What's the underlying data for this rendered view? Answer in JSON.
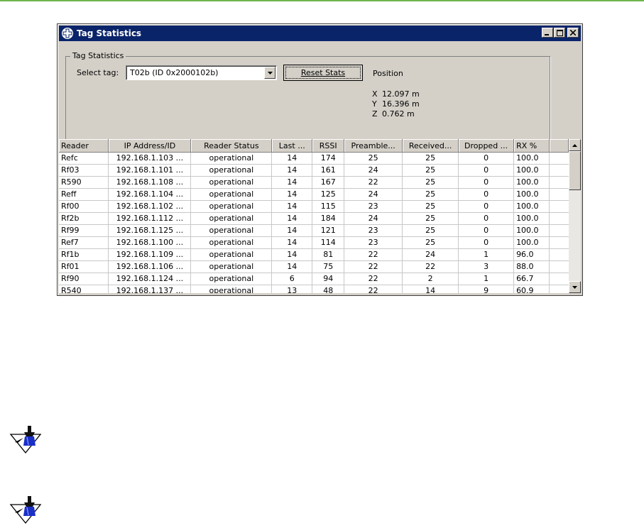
{
  "window": {
    "title": "Tag Statistics"
  },
  "group": {
    "legend": "Tag Statistics",
    "select_label": "Select tag:",
    "selected_tag": "T02b (ID 0x2000102b)",
    "reset_button": "Reset Stats",
    "position_label": "Position",
    "position": [
      {
        "axis": "X",
        "value": "12.097 m"
      },
      {
        "axis": "Y",
        "value": "16.396 m"
      },
      {
        "axis": "Z",
        "value": "0.762 m"
      }
    ]
  },
  "table": {
    "columns": [
      "Reader",
      "IP Address/ID",
      "Reader Status",
      "Last ...",
      "RSSI",
      "Preamble...",
      "Received...",
      "Dropped ...",
      "RX %"
    ],
    "rows": [
      [
        "Refc",
        "192.168.1.103 ...",
        "operational",
        "14",
        "174",
        "25",
        "25",
        "0",
        "100.0"
      ],
      [
        "Rf03",
        "192.168.1.101 ...",
        "operational",
        "14",
        "161",
        "24",
        "25",
        "0",
        "100.0"
      ],
      [
        "R590",
        "192.168.1.108 ...",
        "operational",
        "14",
        "167",
        "22",
        "25",
        "0",
        "100.0"
      ],
      [
        "Reff",
        "192.168.1.104 ...",
        "operational",
        "14",
        "125",
        "24",
        "25",
        "0",
        "100.0"
      ],
      [
        "Rf00",
        "192.168.1.102 ...",
        "operational",
        "14",
        "115",
        "23",
        "25",
        "0",
        "100.0"
      ],
      [
        "Rf2b",
        "192.168.1.112 ...",
        "operational",
        "14",
        "184",
        "24",
        "25",
        "0",
        "100.0"
      ],
      [
        "Rf99",
        "192.168.1.125 ...",
        "operational",
        "14",
        "121",
        "23",
        "25",
        "0",
        "100.0"
      ],
      [
        "Ref7",
        "192.168.1.100 ...",
        "operational",
        "14",
        "114",
        "23",
        "25",
        "0",
        "100.0"
      ],
      [
        "Rf1b",
        "192.168.1.109 ...",
        "operational",
        "14",
        "81",
        "22",
        "24",
        "1",
        "96.0"
      ],
      [
        "Rf01",
        "192.168.1.106 ...",
        "operational",
        "14",
        "75",
        "22",
        "22",
        "3",
        "88.0"
      ],
      [
        "Rf90",
        "192.168.1.124 ...",
        "operational",
        "6",
        "94",
        "22",
        "2",
        "1",
        "66.7"
      ],
      [
        "R540",
        "192.168.1.137 ...",
        "operational",
        "13",
        "48",
        "22",
        "14",
        "9",
        "60.9"
      ]
    ]
  },
  "colors": {
    "titlebar": "#0a246a",
    "window_face": "#d4d0c8",
    "top_rule": "#6fb54a",
    "note_icon_blue": "#1a2fc8"
  },
  "icons": {
    "app": "medical-cross-icon",
    "note": "pushpin-note-icon"
  }
}
